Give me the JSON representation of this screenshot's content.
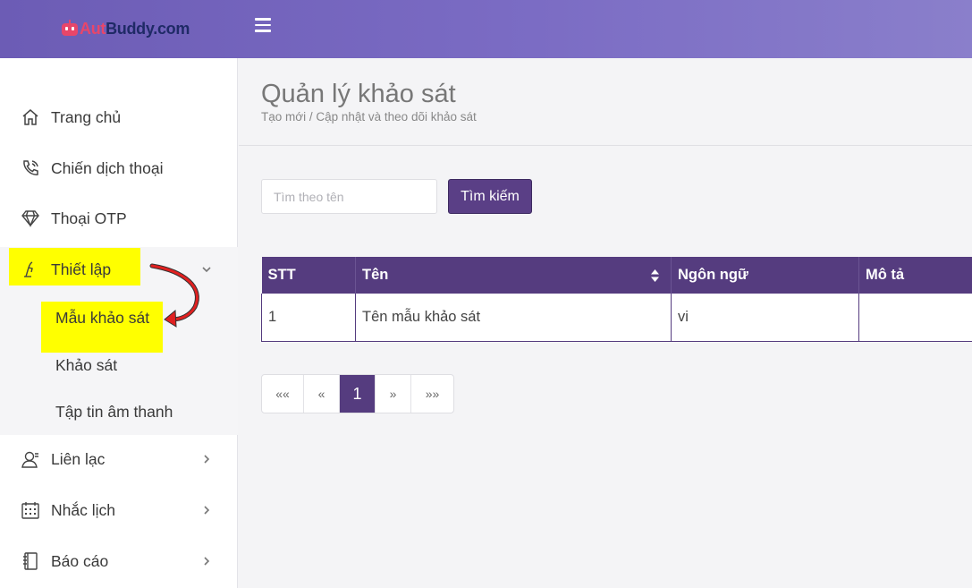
{
  "header": {
    "logo_part1": "Aut",
    "logo_part2": "Buddy.com",
    "menu_icon": "hamburger-icon"
  },
  "sidebar": {
    "items": [
      {
        "label": "Trang chủ",
        "icon": "home-icon"
      },
      {
        "label": "Chiến dịch thoại",
        "icon": "phone-call-icon"
      },
      {
        "label": "Thoại OTP",
        "icon": "diamond-icon"
      },
      {
        "label": "Thiết lập",
        "icon": "settings-icon",
        "expanded": true,
        "children": [
          "Mẫu khảo sát",
          "Khảo sát",
          "Tập tin âm thanh"
        ]
      },
      {
        "label": "Liên lạc",
        "icon": "contact-icon"
      },
      {
        "label": "Nhắc lịch",
        "icon": "calendar-icon"
      },
      {
        "label": "Báo cáo",
        "icon": "report-icon"
      }
    ]
  },
  "page": {
    "title": "Quản lý khảo sát",
    "subtitle": "Tạo mới / Cập nhật và theo dõi khảo sát"
  },
  "search": {
    "placeholder": "Tìm theo tên",
    "value": "",
    "button_label": "Tìm kiếm"
  },
  "table": {
    "columns": [
      "STT",
      "Tên",
      "Ngôn ngữ",
      "Mô tả"
    ],
    "rows": [
      [
        "1",
        "Tên mẫu khảo sát",
        "vi",
        ""
      ]
    ]
  },
  "pagination": {
    "first": "««",
    "prev": "«",
    "current": "1",
    "next": "»",
    "last": "»»"
  },
  "colors": {
    "header_gradient_start": "#6c5cb5",
    "accent": "#553c7f",
    "highlight": "#ffff00",
    "annotation_arrow": "#e02020"
  }
}
